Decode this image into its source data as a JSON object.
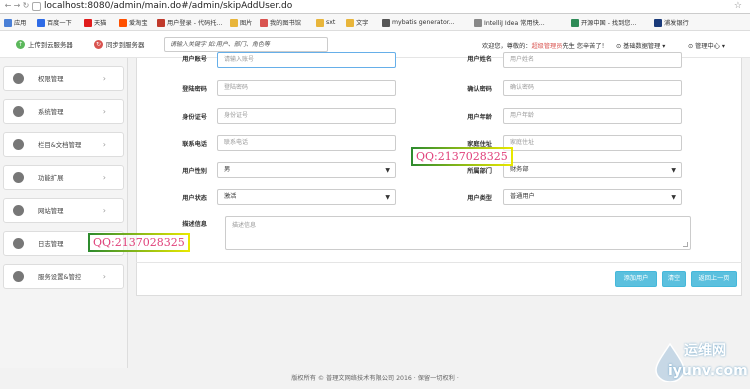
{
  "browser": {
    "url": "localhost:8080/admin/main.do#/admin/skipAddUser.do",
    "bookmarks": [
      {
        "label": "应用",
        "icon": "apps-grid-icon",
        "color": "#4a7fd6"
      },
      {
        "label": "百度一下",
        "icon": "baidu-icon",
        "color": "#2e6be6"
      },
      {
        "label": "天猫",
        "icon": "tmall-icon",
        "color": "#e01c1c"
      },
      {
        "label": "爱淘宝",
        "icon": "aitaobao-icon",
        "color": "#ff5000"
      },
      {
        "label": "用户登录 - 代码托...",
        "icon": "code-hosting-icon",
        "color": "#c0392b"
      },
      {
        "label": "图片",
        "icon": "folder-icon",
        "color": "#e8b53b"
      },
      {
        "label": "我的图书馆",
        "icon": "library-icon",
        "color": "#d9534f"
      },
      {
        "label": "sxt",
        "icon": "folder-icon",
        "color": "#e8b53b"
      },
      {
        "label": "文字",
        "icon": "folder-icon",
        "color": "#e8b53b"
      },
      {
        "label": "mybatis generator...",
        "icon": "globe-icon",
        "color": "#555555"
      },
      {
        "label": "IntelliJ Idea 常用快...",
        "icon": "document-icon",
        "color": "#888888"
      },
      {
        "label": "开源中国 - 找到您...",
        "icon": "oschina-icon",
        "color": "#2e8b57"
      },
      {
        "label": "浦发银行",
        "icon": "spdb-icon",
        "color": "#1a3a7a"
      }
    ]
  },
  "header": {
    "upload_label": "上传到云服务器",
    "sync_label": "同步到服务器",
    "search_placeholder": "请输入关键字 如:用户、部门、角色等",
    "welcome_prefix": "欢迎您，尊敬的：",
    "welcome_role": "超级管理员",
    "welcome_suffix": "先生 您辛苦了！",
    "menu_data": "基础数据管理",
    "menu_admin": "管理中心"
  },
  "sidebar": {
    "items": [
      {
        "label": "权限管理"
      },
      {
        "label": "系统管理"
      },
      {
        "label": "栏目&文档管理"
      },
      {
        "label": "功能扩展"
      },
      {
        "label": "网站管理"
      },
      {
        "label": "日志管理"
      },
      {
        "label": "服务设置&管控"
      }
    ]
  },
  "form": {
    "login_name_label": "用户账号",
    "login_name_placeholder": "请输入账号",
    "user_name_label": "用户姓名",
    "user_name_placeholder": "用户姓名",
    "password_label": "登陆密码",
    "password_placeholder": "登陆密码",
    "confirm_label": "确认密码",
    "confirm_placeholder": "确认密码",
    "idcard_label": "身份证号",
    "idcard_placeholder": "身份证号",
    "age_label": "用户年龄",
    "age_placeholder": "用户年龄",
    "phone_label": "联系电话",
    "phone_placeholder": "联系电话",
    "address_label": "家庭住址",
    "address_placeholder": "家庭住址",
    "gender_label": "用户性别",
    "gender_value": "男",
    "dept_label": "所属部门",
    "dept_value": "财务部",
    "status_label": "用户状态",
    "status_value": "激活",
    "type_label": "用户类型",
    "type_value": "普通用户",
    "desc_label": "描述信息",
    "desc_placeholder": "描述信息"
  },
  "buttons": {
    "add": "添加用户",
    "clear": "清空",
    "back": "返回上一页"
  },
  "footer": {
    "text": "版权所有 © 普理文网络技术有限公司 2016 · 保留一切权利 ·"
  },
  "overlays": {
    "qq_text": "QQ:2137028325",
    "wm_cn": "运维网",
    "wm_en": "iyunv.com"
  }
}
